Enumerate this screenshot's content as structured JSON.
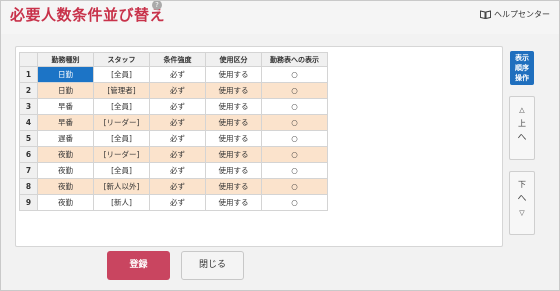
{
  "header": {
    "title": "必要人数条件並び替え",
    "help_mark": "?",
    "help_center_label": "ヘルプセンター",
    "help_icon": "book-icon"
  },
  "table": {
    "columns": [
      "",
      "勤務種別",
      "スタッフ",
      "条件強度",
      "使用区分",
      "勤務表への表示"
    ],
    "rows": [
      {
        "num": "1",
        "shift": "日勤",
        "staff": "[全員]",
        "cond": "必ず",
        "use": "使用する",
        "disp": "○"
      },
      {
        "num": "2",
        "shift": "日勤",
        "staff": "[管理者]",
        "cond": "必ず",
        "use": "使用する",
        "disp": "○"
      },
      {
        "num": "3",
        "shift": "早番",
        "staff": "[全員]",
        "cond": "必ず",
        "use": "使用する",
        "disp": "○"
      },
      {
        "num": "4",
        "shift": "早番",
        "staff": "[リーダー]",
        "cond": "必ず",
        "use": "使用する",
        "disp": "○"
      },
      {
        "num": "5",
        "shift": "遅番",
        "staff": "[全員]",
        "cond": "必ず",
        "use": "使用する",
        "disp": "○"
      },
      {
        "num": "6",
        "shift": "夜勤",
        "staff": "[リーダー]",
        "cond": "必ず",
        "use": "使用する",
        "disp": "○"
      },
      {
        "num": "7",
        "shift": "夜勤",
        "staff": "[全員]",
        "cond": "必ず",
        "use": "使用する",
        "disp": "○"
      },
      {
        "num": "8",
        "shift": "夜勤",
        "staff": "[新人以外]",
        "cond": "必ず",
        "use": "使用する",
        "disp": "○"
      },
      {
        "num": "9",
        "shift": "夜勤",
        "staff": "[新人]",
        "cond": "必ず",
        "use": "使用する",
        "disp": "○"
      }
    ]
  },
  "side": {
    "order_btn_lines": [
      "表示",
      "順序",
      "操作"
    ],
    "up": {
      "tri": "△",
      "label": "上",
      "chev": "へ"
    },
    "down": {
      "label": "下",
      "chev": "へ",
      "tri": "▽"
    }
  },
  "footer": {
    "register_label": "登録",
    "close_label": "閉じる"
  },
  "colors": {
    "title": "#c8324a",
    "selected": "#1c74c6",
    "even_row": "#fbe3cc",
    "primary_button": "#c94560",
    "order_button": "#1f6fbe"
  }
}
